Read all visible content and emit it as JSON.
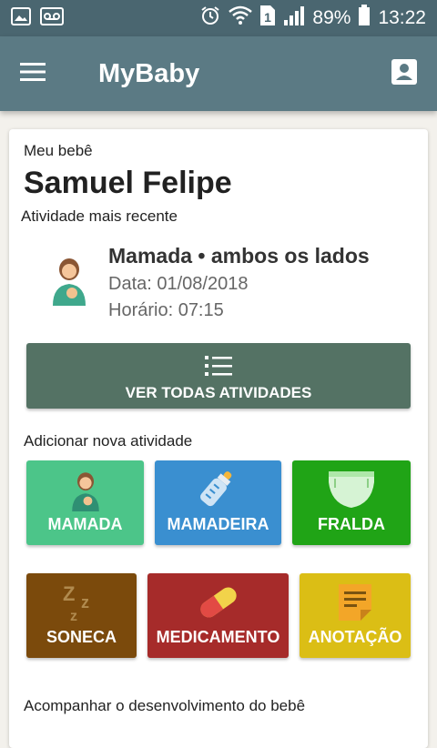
{
  "status_bar": {
    "battery": "89%",
    "time": "13:22",
    "sim_badge": "1",
    "icons": [
      "image-icon",
      "voicemail-icon",
      "alarm-icon",
      "wifi-icon",
      "sim-icon",
      "signal-icon",
      "battery-icon"
    ]
  },
  "app_bar": {
    "title": "MyBaby",
    "menu_icon": "menu-icon",
    "profile_icon": "profile-icon"
  },
  "card": {
    "section_label": "Meu bebê",
    "baby_name": "Samuel Felipe",
    "recent_label": "Atividade mais recente",
    "recent": {
      "title": "Mamada • ambos os lados",
      "date": "Data: 01/08/2018",
      "time": "Horário: 07:15",
      "icon": "breastfeeding-icon"
    },
    "all_button": {
      "label": "VER TODAS ATIVIDADES",
      "icon": "list-icon"
    },
    "add_label": "Adicionar nova atividade",
    "tiles": [
      {
        "label": "MAMADA",
        "color": "#4cc589",
        "icon": "breastfeeding-icon"
      },
      {
        "label": "MAMADEIRA",
        "color": "#3a8fd0",
        "icon": "bottle-icon"
      },
      {
        "label": "FRALDA",
        "color": "#20a416",
        "icon": "diaper-icon"
      },
      {
        "label": "SONECA",
        "color": "#7b4a0c",
        "icon": "sleep-icon"
      },
      {
        "label": "MEDICAMENTO",
        "color": "#a62b2a",
        "icon": "pill-icon"
      },
      {
        "label": "ANOTAÇÃO",
        "color": "#dbbe15",
        "icon": "note-icon"
      }
    ],
    "development_label": "Acompanhar o desenvolvimento do bebê"
  }
}
